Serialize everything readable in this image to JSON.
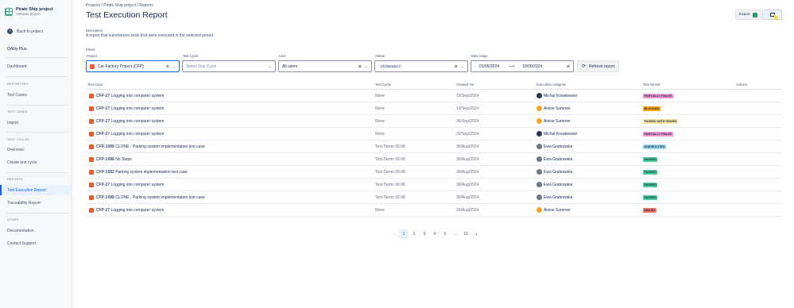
{
  "project": {
    "name": "Pirate Ship project",
    "type": "Software project"
  },
  "sidebar": {
    "back": "Back to project",
    "brand": "QAlity Plus",
    "dashboard": "Dashboard",
    "sections": {
      "repository": "REPOSITORY",
      "test_cases": "TEST CASES",
      "test_cycles": "TEST CYCLES",
      "reports": "REPORTS",
      "other": "OTHER"
    },
    "items": {
      "test_cases": "Test Cases",
      "import": "Import",
      "overview": "Overview",
      "create_cycle": "Create test cycle",
      "exec_report": "Test Execution Report",
      "trace_report": "Traceability Report",
      "documentation": "Documentation",
      "contact": "Contact Support"
    }
  },
  "breadcrumbs": "Projects  /  Pirate Ship project  /  Reports",
  "title": "Test Execution Report",
  "export_label": "Export",
  "description_label": "Description",
  "description": "A report that summarizes tests that were executed in the selected period.",
  "filters": {
    "label": "Filters:",
    "project_label": "Project",
    "project_value": "Car Factory Project (CFP)",
    "cycle_label": "Test Cycle",
    "cycle_placeholder": "Select Test Cycle",
    "user_label": "User",
    "user_value": "All users",
    "status_label": "Status",
    "status_value": "All statuses",
    "date_label": "Date range",
    "date_from": "01/05/2024",
    "date_to": "16/09/2024",
    "refresh": "Refresh report"
  },
  "table": {
    "headers": {
      "case": "Test Case",
      "cycle": "Test Cycle",
      "created": "Created On",
      "assignee": "Execution Assignee",
      "result": "Test Result",
      "actions": "Actions"
    },
    "rows": [
      {
        "key": "CFP-27",
        "name": "Logging into computer system",
        "cycle": "None",
        "created": "13/Sep/2024",
        "assignee": "Michał Kowalewski",
        "avatar": "#253858",
        "result": "PARTIALLY FAILED",
        "color": "#f797d2"
      },
      {
        "key": "CFP-27",
        "name": "Logging into computer system",
        "cycle": "None",
        "created": "13/Sep/2024",
        "assignee": "Aloise Summer",
        "avatar": "#f5a623",
        "result": "BLOCKED",
        "color": "#fca700"
      },
      {
        "key": "CFP-27",
        "name": "Logging into computer system",
        "cycle": "None",
        "created": "06/Sep/2024",
        "assignee": "Aloise Summer",
        "avatar": "#f5a623",
        "result": "PASSED WITH ISSUES",
        "color": "#f8e6a0"
      },
      {
        "key": "CFP-27",
        "name": "Logging into computer system",
        "cycle": "None",
        "created": "02/Sep/2024",
        "assignee": "Michał Kowalewski",
        "avatar": "#253858",
        "result": "PARTIALLY FAILED",
        "color": "#f797d2"
      },
      {
        "key": "CFP-1089",
        "name": "CLONE - Parking system implementation test case",
        "cycle": "Test Demo 30.08",
        "created": "30/Aug/2024",
        "assignee": "Ewa Grabowska",
        "avatar": "#6b778c",
        "result": "UNEXECUTED",
        "color": "#9dd9ee"
      },
      {
        "key": "CFP-1086",
        "name": "No Steps",
        "cycle": "Test Demo 30.08",
        "created": "30/Aug/2024",
        "assignee": "Ewa Grabowska",
        "avatar": "#6b778c",
        "result": "PASSED",
        "color": "#4bce97"
      },
      {
        "key": "CFP-1082",
        "name": "Parking system implementation test case",
        "cycle": "Test Demo 30.08",
        "created": "30/Aug/2024",
        "assignee": "Ewa Grabowska",
        "avatar": "#6b778c",
        "result": "PASSED",
        "color": "#4bce97"
      },
      {
        "key": "CFP-27",
        "name": "Logging into computer system",
        "cycle": "Test Demo 30.08",
        "created": "30/Aug/2024",
        "assignee": "Ewa Grabowska",
        "avatar": "#6b778c",
        "result": "PASSED",
        "color": "#4bce97"
      },
      {
        "key": "CFP-1088",
        "name": "CLONE - Parking system implementation test case",
        "cycle": "Test Demo 30.08",
        "created": "30/Aug/2024",
        "assignee": "Ewa Grabowska",
        "avatar": "#6b778c",
        "result": "PASSED",
        "color": "#4bce97"
      },
      {
        "key": "CFP-27",
        "name": "Logging into computer system",
        "cycle": "None",
        "created": "29/Aug/2024",
        "assignee": "Aloise Summer",
        "avatar": "#f5a623",
        "result": "FAILED",
        "color": "#f87462"
      }
    ]
  },
  "pagination": {
    "pages": [
      "1",
      "2",
      "3",
      "4",
      "5",
      "...",
      "10"
    ],
    "current": "1"
  },
  "colors": {
    "accent": "#0c66e4",
    "sidebar_bg": "#f7f8f9"
  },
  "icons": {
    "back": "arrow-left-icon",
    "refresh": "refresh-icon",
    "export": "spreadsheet-icon",
    "view": "grid-view-icon",
    "clear": "clear-icon",
    "dropdown": "chevron-down-icon"
  }
}
